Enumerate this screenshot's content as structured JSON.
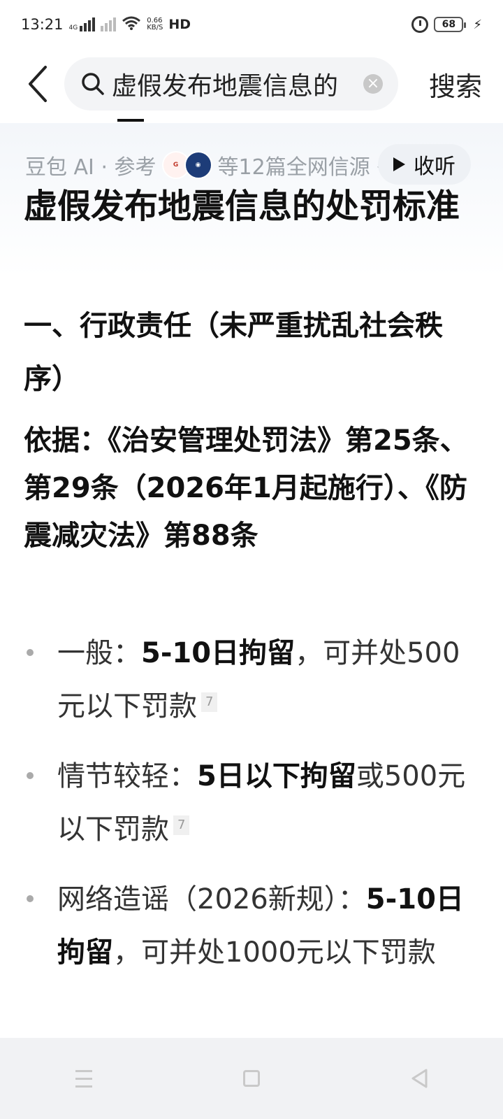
{
  "status_bar": {
    "time": "13:21",
    "network_type": "4G",
    "net_speed_value": "0.66",
    "net_speed_unit": "KB/S",
    "hd_label": "HD",
    "battery": "68"
  },
  "search": {
    "query": "虚假发布地震信息的",
    "button_label": "搜索"
  },
  "answer": {
    "source_prefix": "豆包 AI · 参考",
    "source_suffix": "等12篇全网信源",
    "listen_label": "收听",
    "title": "虚假发布地震信息的处罚标准",
    "section_heading": "一、行政责任（未严重扰乱社会秩序）",
    "basis": "依据：《治安管理处罚法》第25条、第29条（2026年1月起施行）、《防震减灾法》第88条",
    "bullets": [
      {
        "label": "一般：",
        "emph": "5-10日拘留",
        "rest": "，可并处500元以下罚款",
        "cite": "7"
      },
      {
        "label": "情节较轻：",
        "emph": "5日以下拘留",
        "rest": "或500元以下罚款",
        "cite": "7"
      },
      {
        "label": "网络造谣（2026新规）：",
        "emph": "5-10日拘留",
        "rest": "，可并处1000元以下罚款",
        "cite": ""
      }
    ]
  },
  "colors": {
    "muted_text": "#9aa0a6",
    "nav_bar_bg": "#f1f2f4",
    "search_bg": "#f3f4f6"
  },
  "icons": [
    "signal-icon",
    "wifi-icon",
    "alarm-icon",
    "battery-icon",
    "charging-icon",
    "back-arrow-icon",
    "search-icon",
    "clear-icon",
    "play-icon",
    "chevron-down-icon",
    "menu-icon",
    "home-icon",
    "nav-back-icon"
  ]
}
